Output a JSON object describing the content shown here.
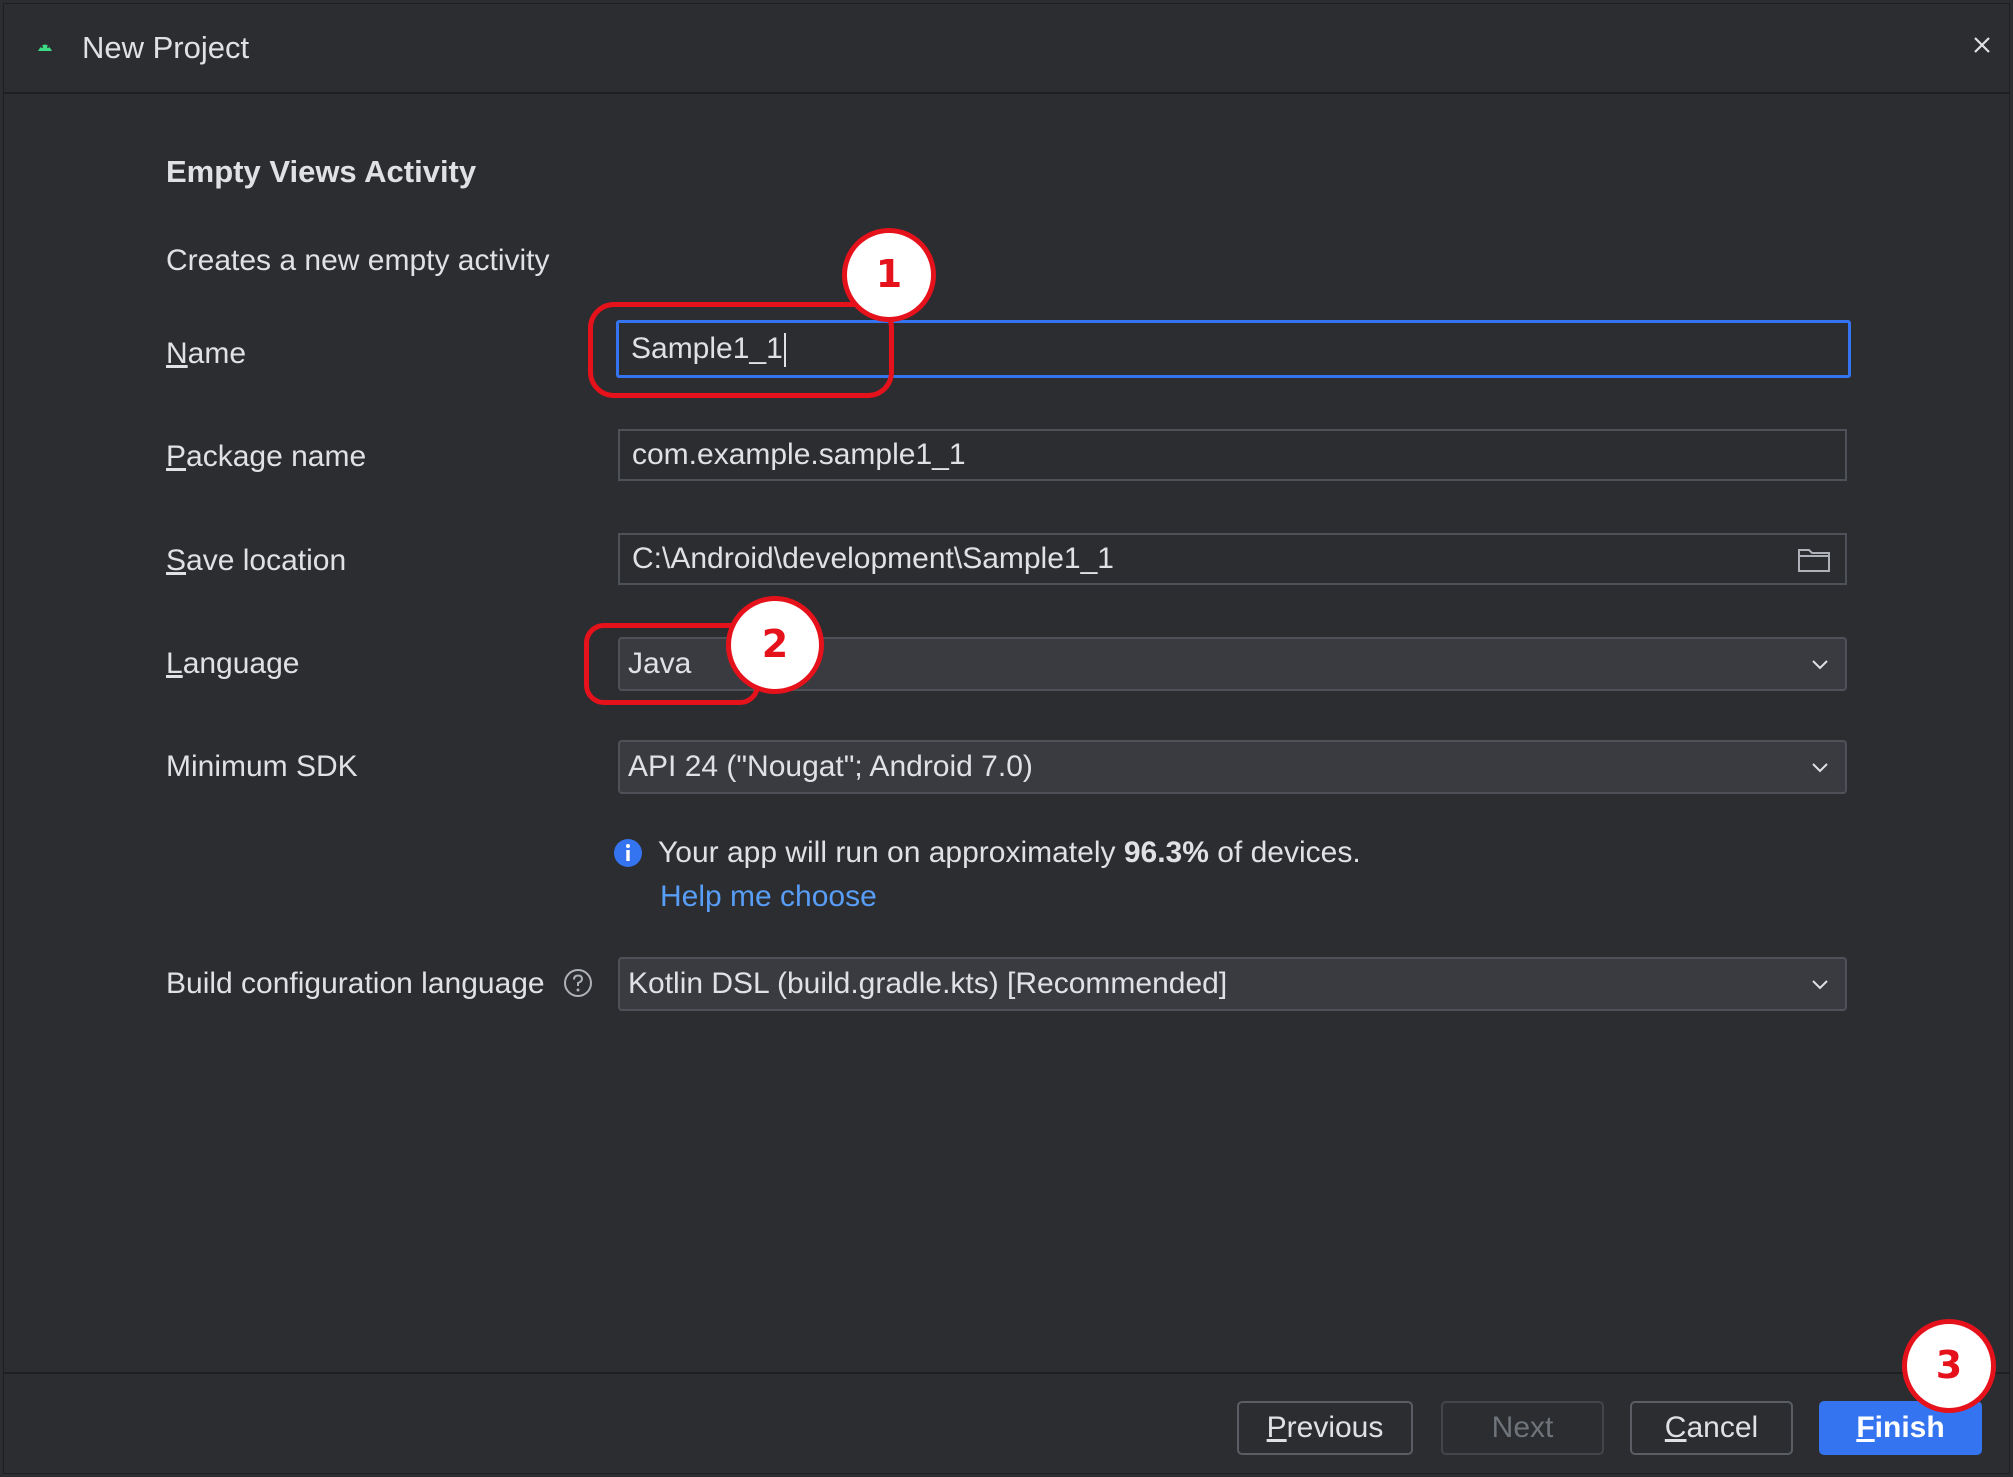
{
  "window": {
    "title": "New Project"
  },
  "header": {
    "title": "Empty Views Activity",
    "description": "Creates a new empty activity"
  },
  "form": {
    "name": {
      "label_u": "N",
      "label_rest": "ame",
      "value": "Sample1_1"
    },
    "package": {
      "label_u": "P",
      "label_rest": "ackage name",
      "value": "com.example.sample1_1"
    },
    "save_location": {
      "label_u": "S",
      "label_rest": "ave location",
      "value": "C:\\Android\\development\\Sample1_1"
    },
    "language": {
      "label_u": "L",
      "label_rest": "anguage",
      "value": "Java"
    },
    "min_sdk": {
      "label": "Minimum SDK",
      "value": "API 24 (\"Nougat\"; Android 7.0)"
    },
    "info": {
      "prefix": "Your app will run on approximately ",
      "percent": "96.3%",
      "suffix": " of devices."
    },
    "help_link": "Help me choose",
    "build_config": {
      "label": "Build configuration language",
      "value": "Kotlin DSL (build.gradle.kts) [Recommended]"
    }
  },
  "buttons": {
    "previous": {
      "u": "P",
      "rest": "revious"
    },
    "next": "Next",
    "cancel": {
      "u": "C",
      "rest": "ancel"
    },
    "finish": {
      "u": "F",
      "rest": "inish"
    }
  },
  "annotations": [
    "1",
    "2",
    "3"
  ],
  "colors": {
    "accent": "#3574f0",
    "annotation": "#e5121c",
    "link": "#589df6"
  }
}
